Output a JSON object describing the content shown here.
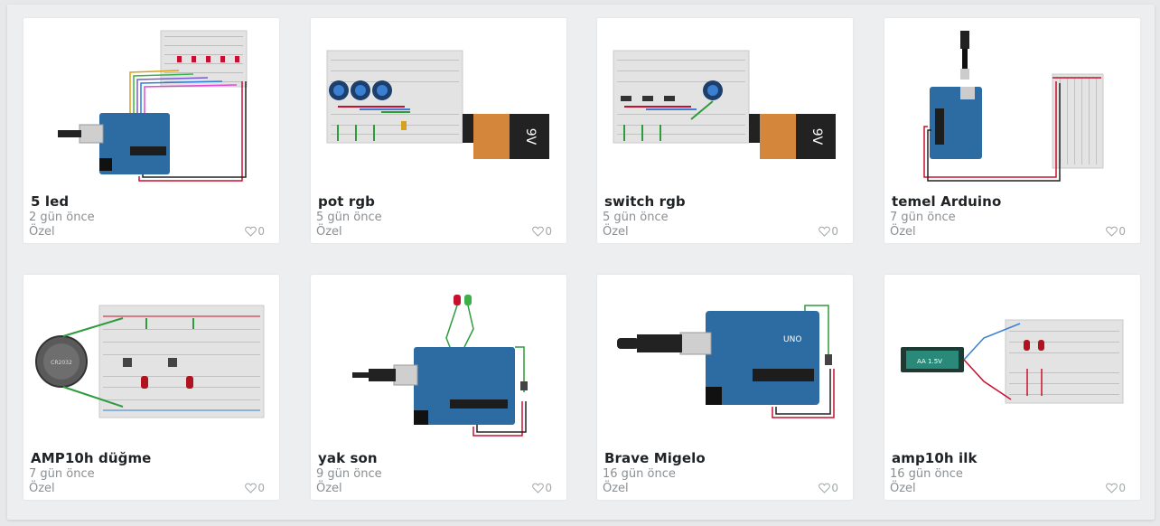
{
  "projects": [
    {
      "title": "5 led",
      "time": "2 gün önce",
      "privacy": "Özel",
      "likes": "0",
      "thumb": "leds"
    },
    {
      "title": "pot rgb",
      "time": "5 gün önce",
      "privacy": "Özel",
      "likes": "0",
      "thumb": "potrgb"
    },
    {
      "title": "switch rgb",
      "time": "5 gün önce",
      "privacy": "Özel",
      "likes": "0",
      "thumb": "switchrgb"
    },
    {
      "title": "temel Arduino",
      "time": "7 gün önce",
      "privacy": "Özel",
      "likes": "0",
      "thumb": "temel"
    },
    {
      "title": "AMP10h düğme",
      "time": "7 gün önce",
      "privacy": "Özel",
      "likes": "0",
      "thumb": "button"
    },
    {
      "title": "yak son",
      "time": "9 gün önce",
      "privacy": "Özel",
      "likes": "0",
      "thumb": "yakson"
    },
    {
      "title": "Brave Migelo",
      "time": "16 gün önce",
      "privacy": "Özel",
      "likes": "0",
      "thumb": "brave"
    },
    {
      "title": "amp10h ilk",
      "time": "16 gün önce",
      "privacy": "Özel",
      "likes": "0",
      "thumb": "ilk"
    }
  ],
  "thumb_text": {
    "battery_9v": "9V",
    "uno": "UNO",
    "coin_cell": "CR2032",
    "aa_cell": "AA 1.5V"
  },
  "icons": {
    "like": "heart-icon"
  },
  "colors": {
    "background": "#e6e8ea",
    "card": "#ffffff",
    "arduino": "#2d6ca2",
    "title": "#1f2326",
    "meta": "#8a8f93"
  }
}
